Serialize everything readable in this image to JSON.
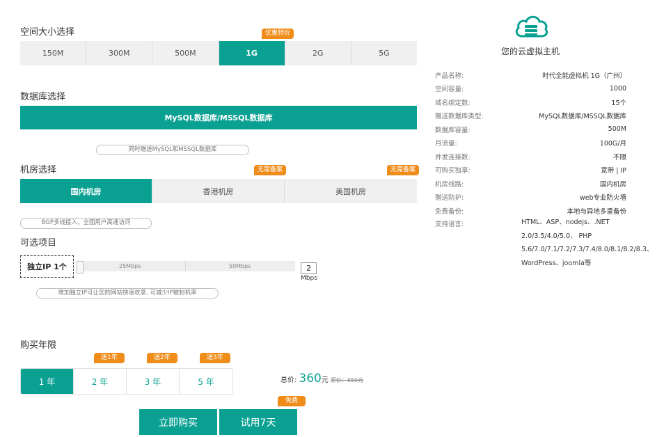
{
  "space": {
    "title": "空间大小选择",
    "badge": "优惠特价",
    "options": [
      "150M",
      "300M",
      "500M",
      "1G",
      "2G",
      "5G"
    ]
  },
  "database": {
    "title": "数据库选择",
    "option": "MySQL数据库/MSSQL数据库",
    "hint": "同时赠送MySQL和MSSQL数据库"
  },
  "room": {
    "title": "机房选择",
    "badge": "无需备案",
    "options": [
      "国内机房",
      "香港机房",
      "美国机房"
    ],
    "hint": "BGP多线接入，全国用户高速访问"
  },
  "optional": {
    "title": "可选项目",
    "ip_label": "独立IP 1个",
    "marks": [
      "25Mbps",
      "50Mbps"
    ],
    "bandwidth_value": "2",
    "unit": "Mbps",
    "hint": "增加独立IP可让您的网站快速收录, 可减少IP被封机率"
  },
  "years": {
    "title": "购买年限",
    "options": [
      "1 年",
      "2 年",
      "3 年",
      "5 年"
    ],
    "gifts": [
      "送1年",
      "送2年",
      "送3年"
    ]
  },
  "price": {
    "label": "总价:",
    "value": "360",
    "unit": "元",
    "original": "原价：880元"
  },
  "buttons": {
    "buy": "立即购买",
    "trial": "试用7天",
    "free_badge": "免费"
  },
  "product": {
    "title": "您的云虚拟主机",
    "accent": "#0aa193",
    "rows": [
      {
        "label": "产品名称:",
        "value": "时代全能虚拟机 1G（广州）"
      },
      {
        "label": "空间容量:",
        "value": "1000"
      },
      {
        "label": "域名绑定数:",
        "value": "15个"
      },
      {
        "label": "赠送数据库类型:",
        "value": "MySQL数据库/MSSQL数据库"
      },
      {
        "label": "数据库容量:",
        "value": "500M"
      },
      {
        "label": "月流量:",
        "value": "100G/月"
      },
      {
        "label": "并发连接数:",
        "value": "不限"
      },
      {
        "label": "可购买独享:",
        "value": "宽带 | IP"
      },
      {
        "label": "机房线路:",
        "value": "国内机房"
      },
      {
        "label": "赠送防护:",
        "value": "web专业防火墙"
      },
      {
        "label": "免费备份:",
        "value": "本地与异地多重备份"
      }
    ],
    "lang_label": "支持语言:",
    "lang_lines": [
      "HTML、ASP、nodejs、.NET",
      "2.0/3.5/4.0/5.0、 PHP",
      "5.6/7.0/7.1/7.2/7.3/7.4/8.0/8.1/8.2/8.3、",
      "WordPress、joomla等"
    ]
  }
}
